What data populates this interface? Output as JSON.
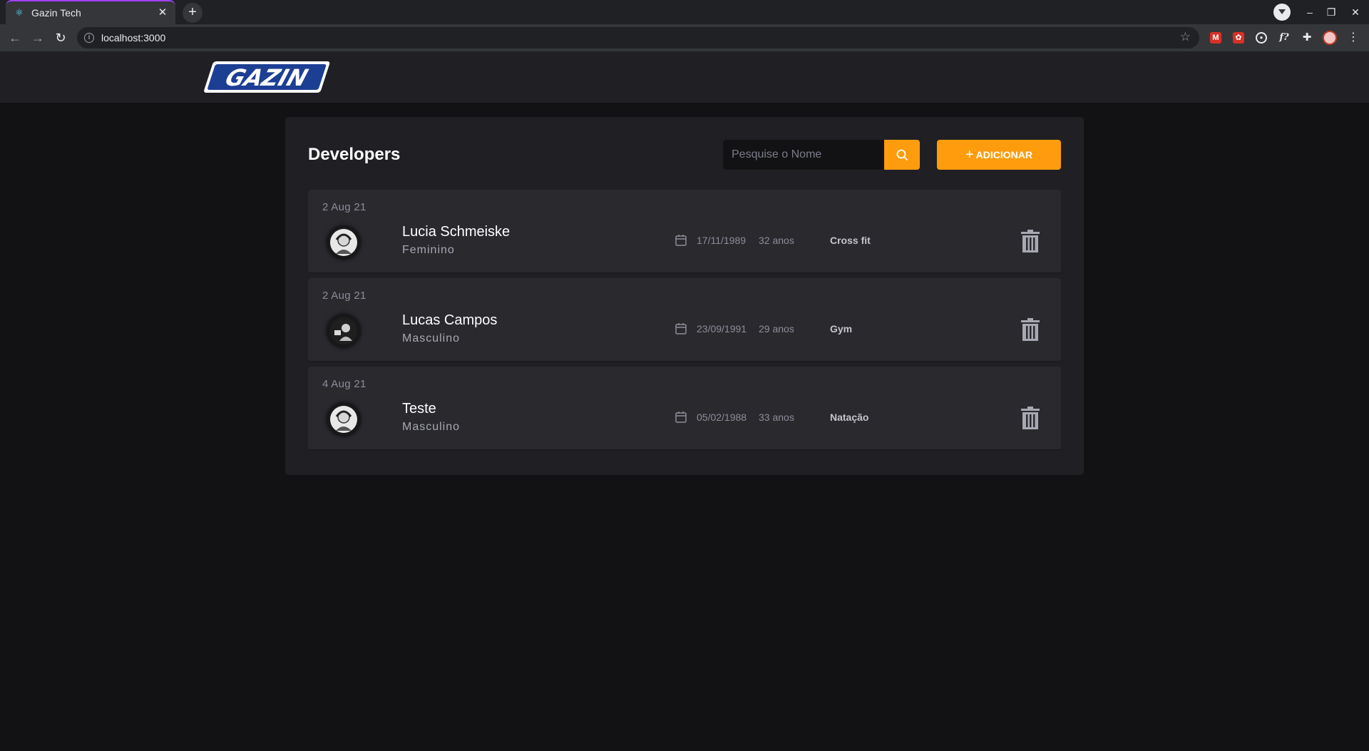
{
  "browser": {
    "tab_title": "Gazin Tech",
    "url": "localhost:3000"
  },
  "header": {
    "logo_text": "GAZIN"
  },
  "page": {
    "title": "Developers",
    "search_placeholder": "Pesquise o Nome",
    "add_button_label": "ADICIONAR",
    "accent_color": "#fe9c0d"
  },
  "developers": [
    {
      "date": "2 Aug 21",
      "name": "Lucia Schmeiske",
      "gender": "Feminino",
      "birth": "17/11/1989",
      "age": "32 anos",
      "hobby": "Cross fit"
    },
    {
      "date": "2 Aug 21",
      "name": "Lucas Campos",
      "gender": "Masculino",
      "birth": "23/09/1991",
      "age": "29 anos",
      "hobby": "Gym"
    },
    {
      "date": "4 Aug 21",
      "name": "Teste",
      "gender": "Masculino",
      "birth": "05/02/1988",
      "age": "33 anos",
      "hobby": "Natação"
    }
  ]
}
